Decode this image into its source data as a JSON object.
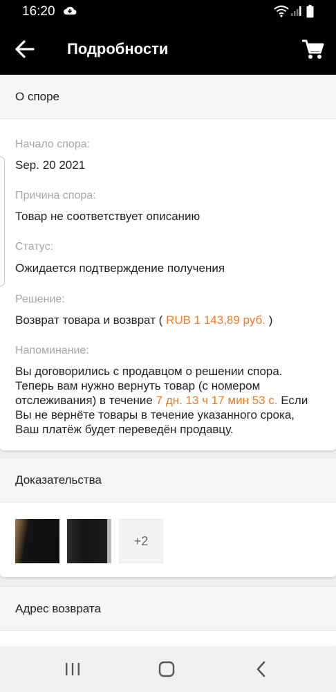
{
  "status_bar": {
    "time": "16:20",
    "icons": [
      "cloud-icon",
      "wifi-icon",
      "signal-icon",
      "battery-icon"
    ]
  },
  "app_bar": {
    "title": "Подробности",
    "back_icon": "back-arrow-icon",
    "cart_icon": "cart-icon"
  },
  "dispute": {
    "section_title": "О споре",
    "start_label": "Начало спора:",
    "start_value": "Sep. 20 2021",
    "reason_label": "Причина спора:",
    "reason_value": "Товар не соответствует описанию",
    "status_label": "Статус:",
    "status_value": "Ожидается подтверждение получения",
    "solution_label": "Решение:",
    "solution_prefix": "Возврат товара и возврат (",
    "solution_amount": " RUB 1 143,89 руб. ",
    "solution_suffix": ")",
    "reminder_label": "Напоминание:",
    "reminder_text_1": "Вы договорились с продавцом о решении спора. Теперь вам нужно вернуть товар (с номером отслеживания) в течение ",
    "reminder_deadline": "7 дн. 13 ч 17 мин 53 с.",
    "reminder_text_2": " Если Вы не вернёте товары в течение указанного срока, Ваш платёж будет переведён продавцу."
  },
  "evidence": {
    "section_title": "Доказательства",
    "more_count": "+2"
  },
  "return_address": {
    "section_title": "Адрес возврата"
  },
  "colors": {
    "accent": "#f07a23",
    "bar": "#000000",
    "label": "#a6a6a6"
  }
}
